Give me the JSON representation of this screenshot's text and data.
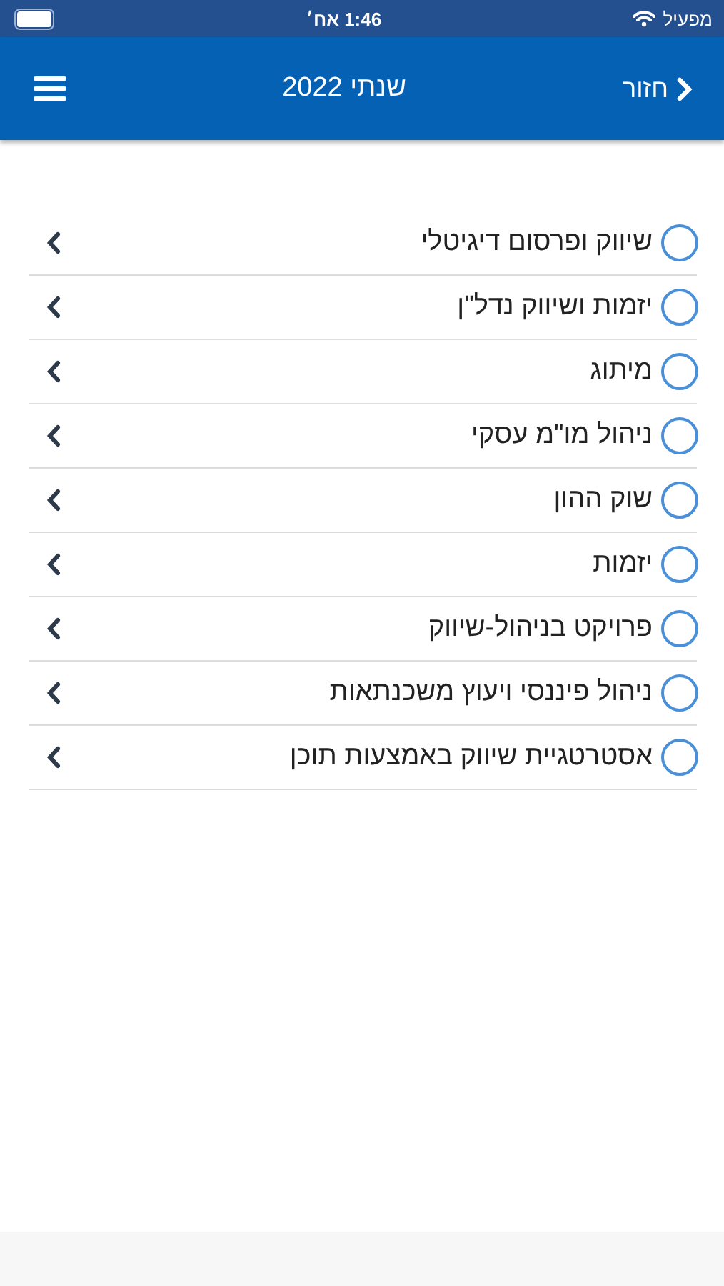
{
  "status_bar": {
    "carrier": "מפעיל",
    "time": "1:46 אח׳"
  },
  "header": {
    "back": "חזור",
    "title": "שנתי 2022"
  },
  "items": [
    {
      "label": "שיווק ופרסום דיגיטלי",
      "checked": false
    },
    {
      "label": "יזמות ושיווק נדל\"ן",
      "checked": false
    },
    {
      "label": "מיתוג",
      "checked": false
    },
    {
      "label": "ניהול מו\"מ עסקי",
      "checked": false
    },
    {
      "label": "שוק ההון",
      "checked": false
    },
    {
      "label": "יזמות",
      "checked": false
    },
    {
      "label": "פרויקט בניהול-שיווק",
      "checked": false
    },
    {
      "label": "ניהול פיננסי ויעוץ משכנתאות",
      "checked": false
    },
    {
      "label": "אסטרטגיית שיווק באמצעות תוכן",
      "checked": false
    }
  ]
}
